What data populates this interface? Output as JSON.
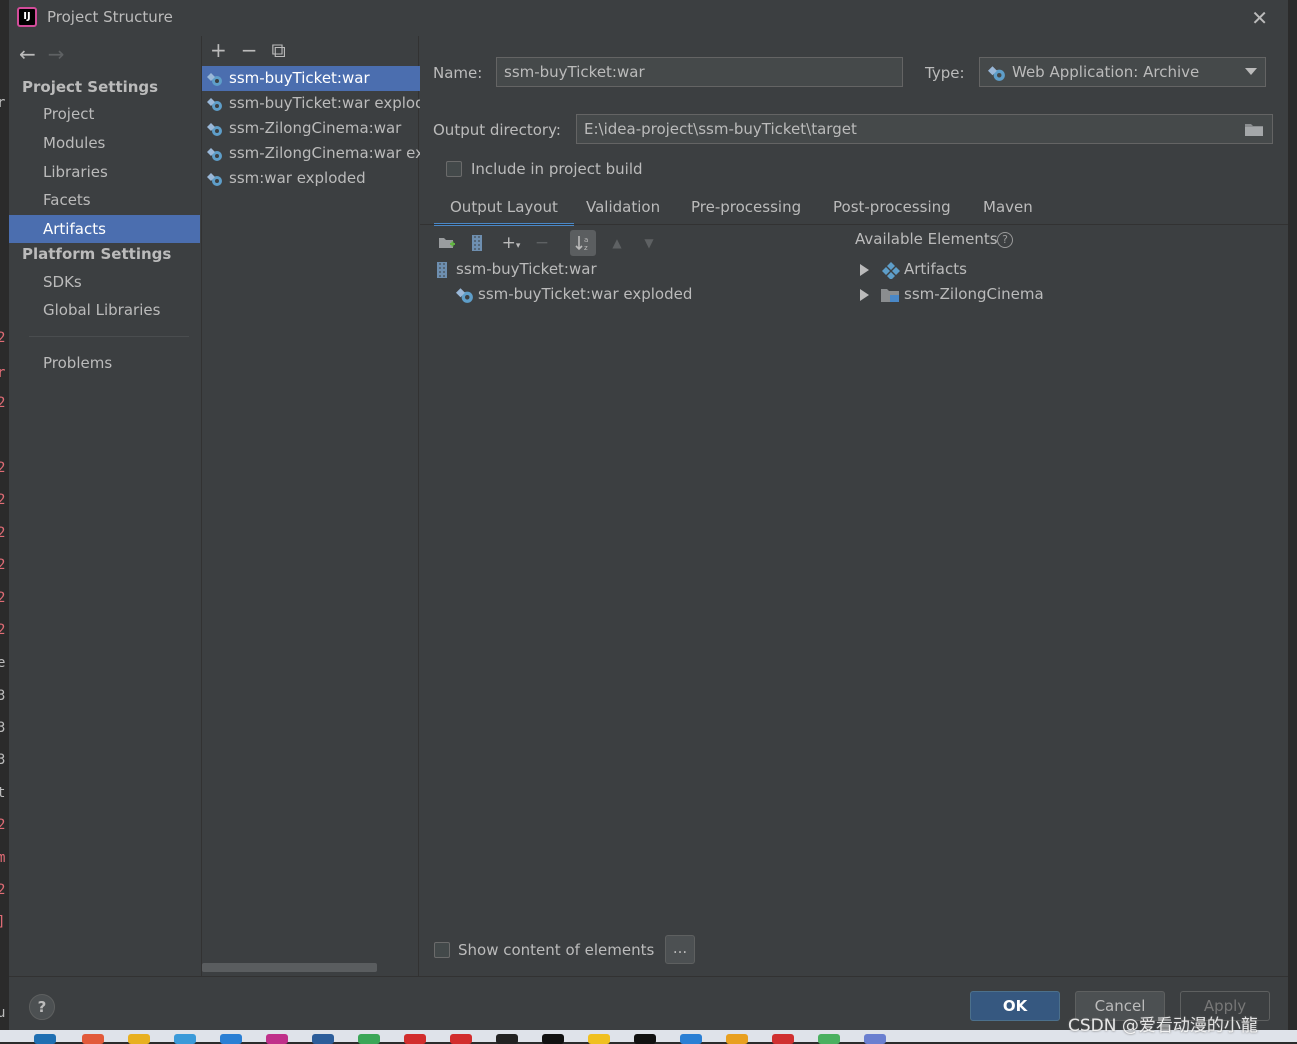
{
  "window": {
    "title": "Project Structure",
    "logo_text": "IJ"
  },
  "nav": {
    "back_icon": "←",
    "forward_icon": "→",
    "project_settings_header": "Project Settings",
    "project_settings_items": [
      "Project",
      "Modules",
      "Libraries",
      "Facets",
      "Artifacts"
    ],
    "platform_settings_header": "Platform Settings",
    "platform_settings_items": [
      "SDKs",
      "Global Libraries"
    ],
    "problems": "Problems",
    "selected": "Artifacts"
  },
  "artifacts_panel": {
    "toolbar": {
      "add": "+",
      "remove": "−",
      "copy": "⧉"
    },
    "items": [
      "ssm-buyTicket:war",
      "ssm-buyTicket:war exploded",
      "ssm-ZilongCinema:war",
      "ssm-ZilongCinema:war exploded",
      "ssm:war exploded"
    ],
    "selected_index": 0
  },
  "details": {
    "name_label": "Name:",
    "name_value": "ssm-buyTicket:war",
    "type_label": "Type:",
    "type_value": "Web Application: Archive",
    "output_dir_label": "Output directory:",
    "output_dir_value": "E:\\idea-project\\ssm-buyTicket\\target",
    "include_build_label": "Include in project build",
    "include_build_checked": false,
    "tabs": [
      "Output Layout",
      "Validation",
      "Pre-processing",
      "Post-processing",
      "Maven"
    ],
    "active_tab": "Output Layout",
    "layout_tree": [
      {
        "label": "ssm-buyTicket:war",
        "level": 0
      },
      {
        "label": "ssm-buyTicket:war exploded",
        "level": 1
      }
    ],
    "available_elements_label": "Available Elements",
    "available_elements": [
      "Artifacts",
      "ssm-ZilongCinema"
    ],
    "show_content_label": "Show content of elements",
    "show_content_checked": false,
    "ellipsis": "..."
  },
  "footer": {
    "help": "?",
    "ok": "OK",
    "cancel": "Cancel",
    "apply": "Apply"
  },
  "watermark": "CSDN @爱看动漫的小龍",
  "colors": {
    "selection": "#4b6eaf",
    "ok_button": "#365880",
    "tab_underline": "#4a88c7",
    "background": "#3c3f41"
  }
}
